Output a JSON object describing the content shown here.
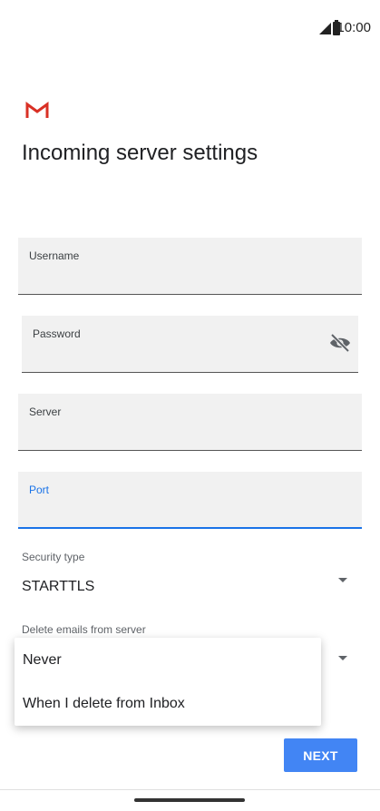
{
  "status_bar": {
    "time": "10:00"
  },
  "screen": {
    "title": "Incoming server settings",
    "fields": {
      "username": {
        "label": "Username",
        "value": ""
      },
      "password": {
        "label": "Password",
        "value": ""
      },
      "server": {
        "label": "Server",
        "value": ""
      },
      "port": {
        "label": "Port",
        "value": ""
      }
    },
    "security_type": {
      "label": "Security type",
      "value": "STARTTLS"
    },
    "delete_emails": {
      "label": "Delete emails from server",
      "options": [
        "Never",
        "When I delete from Inbox"
      ]
    },
    "next_label": "NEXT"
  },
  "colors": {
    "accent": "#1a73e8",
    "button": "#4285f4",
    "field_background": "#f1f1f1"
  },
  "icons": [
    "gmail-logo",
    "signal-icon",
    "battery-icon",
    "visibility-off-icon",
    "dropdown-caret-icon"
  ]
}
